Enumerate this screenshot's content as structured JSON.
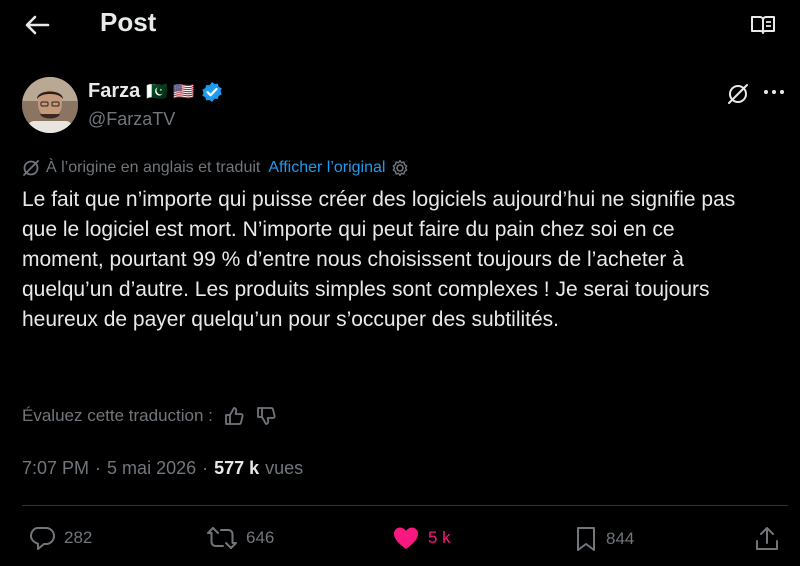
{
  "header": {
    "title": "Post"
  },
  "author": {
    "name": "Farza",
    "flags": [
      "🇵🇰",
      "🇺🇸"
    ],
    "handle": "@FarzaTV"
  },
  "translation": {
    "note": "À l’origine en anglais et traduit",
    "show_original": "Afficher l’original",
    "rate_prompt": "Évaluez cette traduction :"
  },
  "post": {
    "text": "Le fait que n’importe qui puisse créer des logiciels aujourd’hui ne signifie pas que le logiciel est mort. N’importe qui peut faire du pain chez soi en ce moment, pourtant 99 % d’entre nous choisissent toujours de l’acheter à quelqu’un d’autre. Les produits simples sont complexes ! Je serai toujours heureux de payer quelqu’un pour s’occuper des subtilités.",
    "time": "7:07 PM",
    "date": "5 mai 2026",
    "views_count": "577 k",
    "views_label": "vues"
  },
  "actions": {
    "replies": "282",
    "reposts": "646",
    "likes": "5 k",
    "bookmarks": "844"
  },
  "colors": {
    "background": "#000000",
    "text": "#e7e9ea",
    "muted": "#71767b",
    "link": "#1d9bf0",
    "like": "#f91880",
    "verified": "#1d9bf0"
  },
  "icons": [
    "back-arrow-icon",
    "reader-mode-icon",
    "verified-badge-icon",
    "grok-icon",
    "more-icon",
    "translate-icon",
    "settings-icon",
    "thumbs-up-icon",
    "thumbs-down-icon",
    "reply-icon",
    "repost-icon",
    "like-icon",
    "bookmark-icon",
    "share-icon"
  ]
}
